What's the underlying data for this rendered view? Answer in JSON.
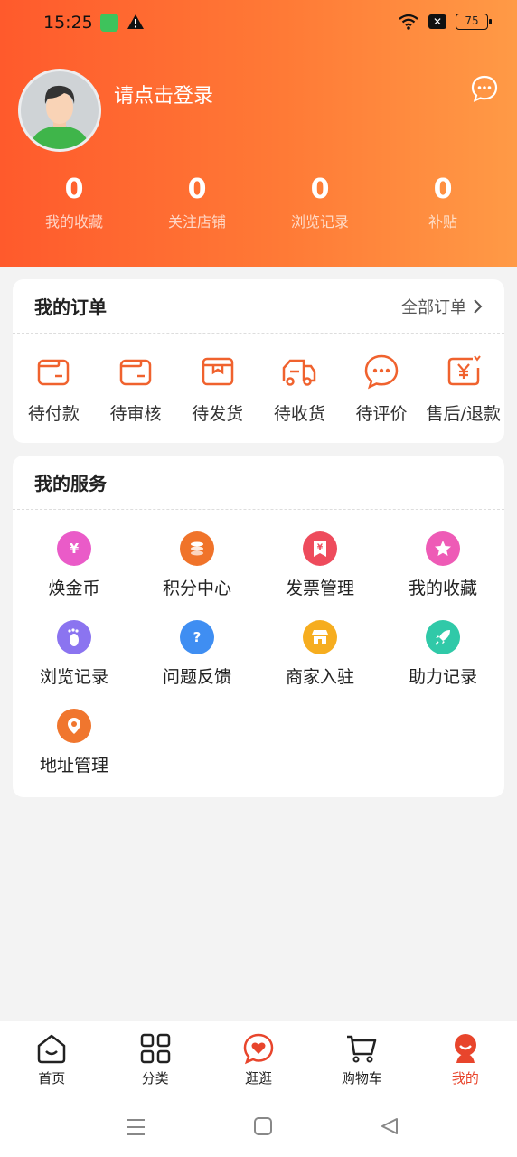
{
  "status": {
    "time": "15:25",
    "battery": "75"
  },
  "profile": {
    "login_prompt": "请点击登录"
  },
  "stats": [
    {
      "value": "0",
      "label": "我的收藏"
    },
    {
      "value": "0",
      "label": "关注店铺"
    },
    {
      "value": "0",
      "label": "浏览记录"
    },
    {
      "value": "0",
      "label": "补贴"
    }
  ],
  "orders": {
    "title": "我的订单",
    "all_label": "全部订单",
    "items": [
      {
        "label": "待付款",
        "icon": "wallet-icon"
      },
      {
        "label": "待审核",
        "icon": "wallet-review-icon"
      },
      {
        "label": "待发货",
        "icon": "package-icon"
      },
      {
        "label": "待收货",
        "icon": "truck-icon"
      },
      {
        "label": "待评价",
        "icon": "comment-icon"
      },
      {
        "label": "售后/退款",
        "icon": "refund-icon"
      }
    ]
  },
  "services": {
    "title": "我的服务",
    "items": [
      {
        "label": "焕金币",
        "icon": "coin-bag-icon",
        "color": "#ea5bc8"
      },
      {
        "label": "积分中心",
        "icon": "points-icon",
        "color": "#f0732a"
      },
      {
        "label": "发票管理",
        "icon": "invoice-icon",
        "color": "#ee4b5c"
      },
      {
        "label": "我的收藏",
        "icon": "star-icon",
        "color": "#ee5bb6"
      },
      {
        "label": "浏览记录",
        "icon": "footprint-icon",
        "color": "#8b74f0"
      },
      {
        "label": "问题反馈",
        "icon": "question-icon",
        "color": "#3f8ef2"
      },
      {
        "label": "商家入驻",
        "icon": "shop-icon",
        "color": "#f6ad1f"
      },
      {
        "label": "助力记录",
        "icon": "rocket-icon",
        "color": "#30c9a8"
      },
      {
        "label": "地址管理",
        "icon": "location-icon",
        "color": "#f0762e"
      }
    ]
  },
  "tabbar": [
    {
      "label": "首页",
      "icon": "home-icon",
      "active": false
    },
    {
      "label": "分类",
      "icon": "category-icon",
      "active": false
    },
    {
      "label": "逛逛",
      "icon": "heart-chat-icon",
      "active": false
    },
    {
      "label": "购物车",
      "icon": "cart-icon",
      "active": false
    },
    {
      "label": "我的",
      "icon": "profile-icon",
      "active": true
    }
  ],
  "colors": {
    "accent": "#ff5a2c",
    "active_tab": "#e8452c",
    "icon_orange": "#f0622e"
  }
}
